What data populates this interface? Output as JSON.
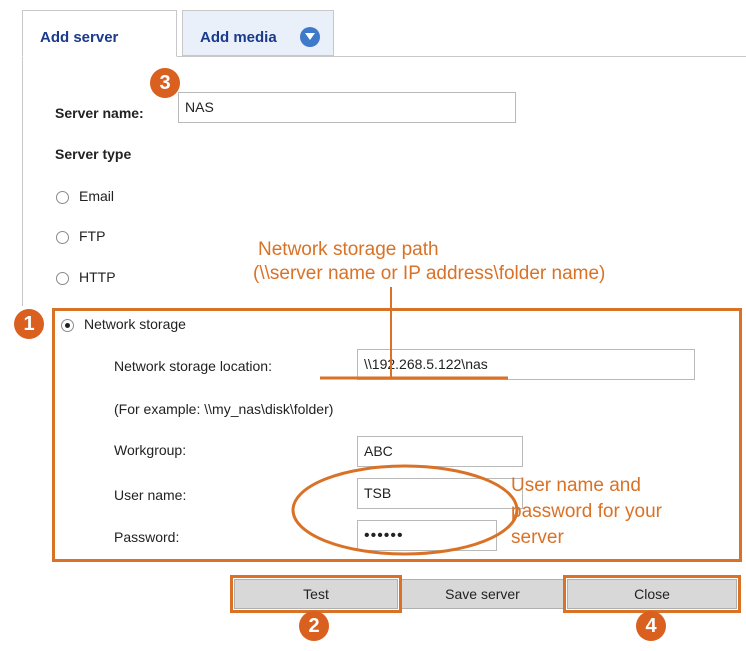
{
  "tabs": {
    "add_server": "Add server",
    "add_media": "Add media",
    "add_media_icon": "chevron-down-circle-icon"
  },
  "form": {
    "server_name_label": "Server name:",
    "server_name_value": "NAS",
    "server_type_label": "Server type",
    "server_types": [
      {
        "label": "Email",
        "selected": false
      },
      {
        "label": "FTP",
        "selected": false
      },
      {
        "label": "HTTP",
        "selected": false
      },
      {
        "label": "Network storage",
        "selected": true
      }
    ],
    "network_storage": {
      "location_label": "Network storage location:",
      "location_value": "\\\\192.268.5.122\\nas",
      "example_text": "(For example: \\\\my_nas\\disk\\folder)",
      "workgroup_label": "Workgroup:",
      "workgroup_value": "ABC",
      "username_label": "User name:",
      "username_value": "TSB",
      "password_label": "Password:",
      "password_value": "••••••"
    }
  },
  "buttons": {
    "test": "Test",
    "save_server": "Save server",
    "close": "Close"
  },
  "annotations": {
    "path_note_line1": "Network storage path",
    "path_note_line2": "(\\\\server name or IP address\\folder name)",
    "user_note_line1": "User name and",
    "user_note_line2": "password for your",
    "user_note_line3": "server",
    "badges": [
      "1",
      "2",
      "3",
      "4"
    ],
    "accent_color": "#d97226"
  }
}
